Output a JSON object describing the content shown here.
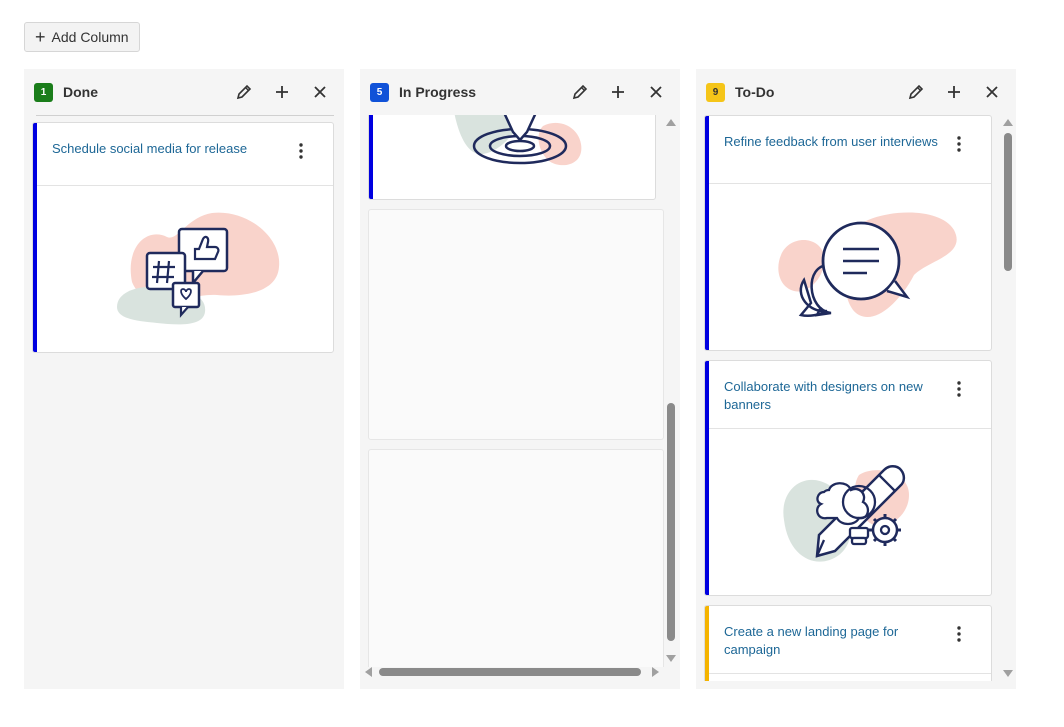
{
  "toolbar": {
    "add_column_label": "Add Column",
    "add_icon": "plus-icon"
  },
  "colors": {
    "blue_stripe": "#0000e0",
    "yellow_stripe": "#f5b400",
    "link_text": "#1d6796"
  },
  "columns": [
    {
      "title": "Done",
      "count": "1",
      "badge_color": "#1a7d1a",
      "cards": [
        {
          "title": "Schedule social media for release",
          "stripe_color": "#0000e0",
          "art": "social-media-illustration"
        }
      ]
    },
    {
      "title": "In Progress",
      "count": "5",
      "badge_color": "#1052d8",
      "cards": [
        {
          "title": "",
          "stripe_color": "#0000e0",
          "art": "target-illustration"
        }
      ]
    },
    {
      "title": "To-Do",
      "count": "9",
      "badge_color": "#f5c518",
      "cards": [
        {
          "title": "Refine feedback from user interviews",
          "stripe_color": "#0000e0",
          "art": "chat-bubbles-illustration"
        },
        {
          "title": "Collaborate with designers on new banners",
          "stripe_color": "#0000e0",
          "art": "creative-idea-illustration"
        },
        {
          "title": "Create a new landing page for campaign",
          "stripe_color": "#f5b400",
          "art": ""
        }
      ]
    }
  ]
}
